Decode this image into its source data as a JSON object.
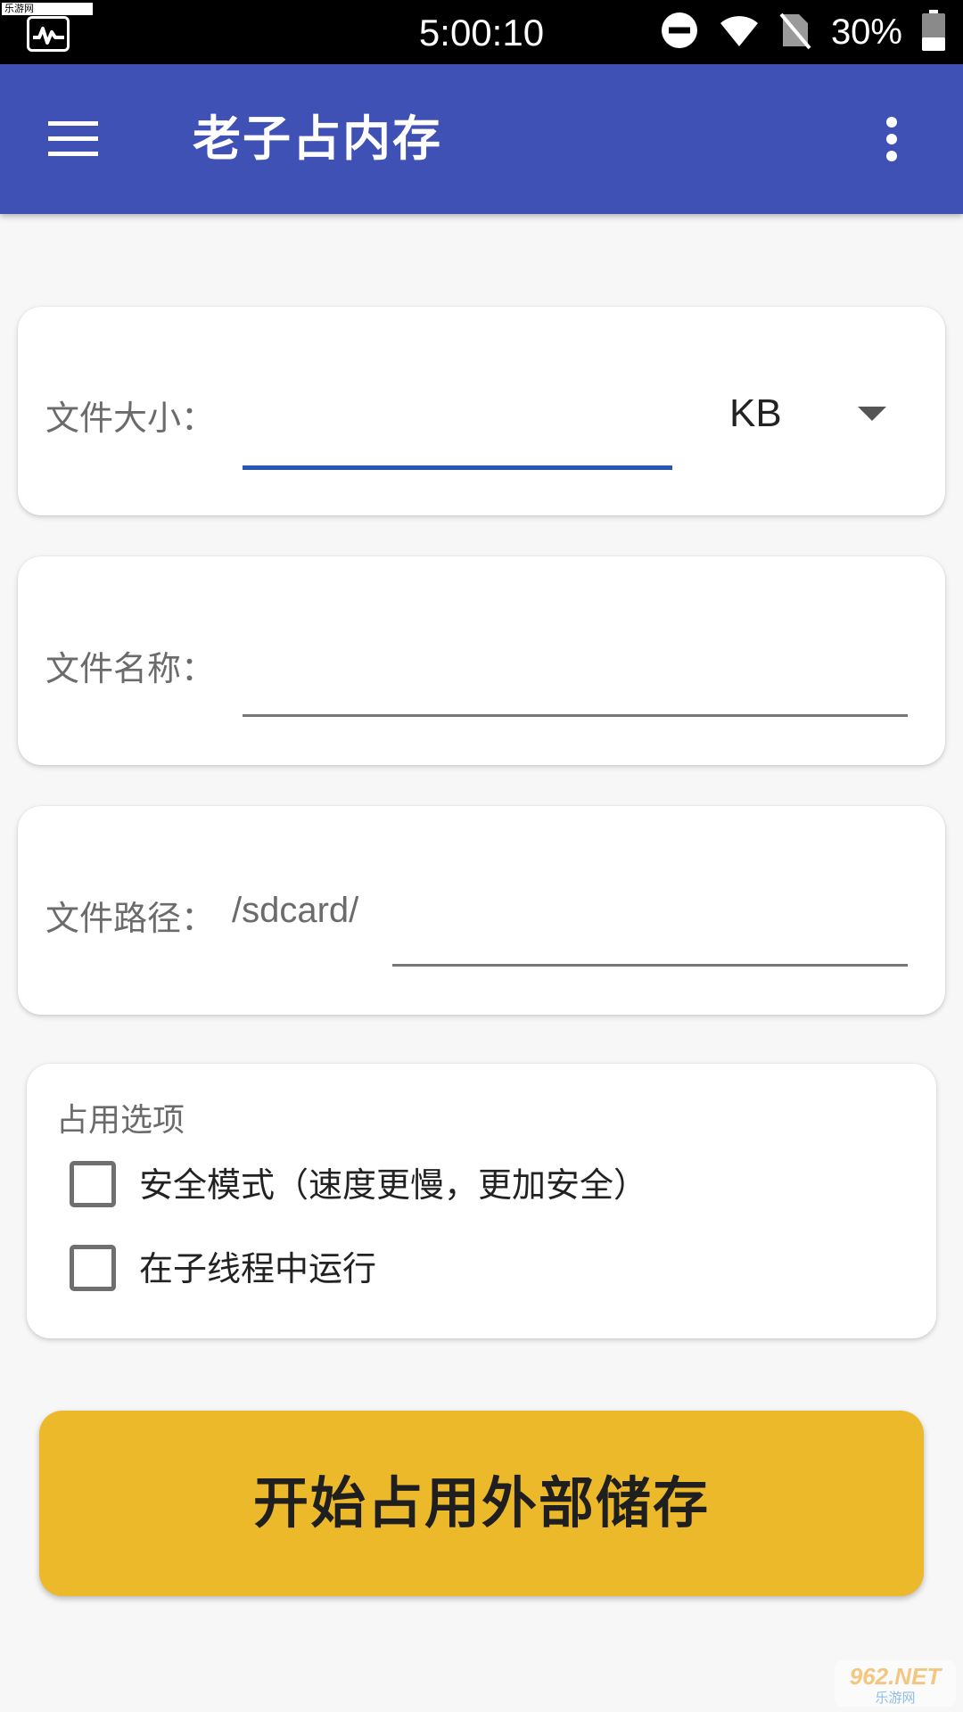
{
  "status_bar": {
    "watermark": "乐游网 www.962.net",
    "time": "5:00:10",
    "battery": "30%",
    "icons": [
      "activity-monitor-icon",
      "do-not-disturb-icon",
      "wifi-icon",
      "no-sim-icon",
      "battery-icon"
    ]
  },
  "app_bar": {
    "title": "老子占内存",
    "menu_icon": "hamburger-menu-icon",
    "overflow_icon": "more-vert-icon"
  },
  "file_size": {
    "label": "文件大小：",
    "value": "",
    "unit": "KB",
    "accent_color": "#2657b8"
  },
  "file_name": {
    "label": "文件名称：",
    "value": ""
  },
  "file_path": {
    "label": "文件路径：",
    "prefix": "/sdcard/",
    "value": ""
  },
  "options": {
    "heading": "占用选项",
    "items": [
      {
        "label": "安全模式（速度更慢，更加安全）",
        "checked": false
      },
      {
        "label": "在子线程中运行",
        "checked": false
      }
    ]
  },
  "action": {
    "start_label": "开始占用外部储存",
    "color": "#ecb92a"
  },
  "colors": {
    "app_bar": "#3f51b5",
    "background": "#f7f7f7"
  },
  "logo_watermark": {
    "brand": "962.NET",
    "sub": "乐游网"
  }
}
